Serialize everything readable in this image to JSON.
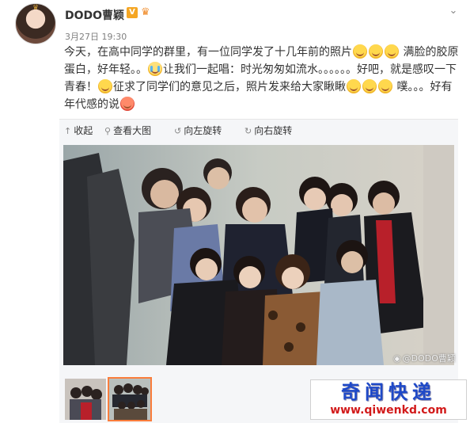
{
  "header": {
    "username": "DODO曹颖",
    "verified_badge": "V",
    "time": "3月27日 19:30",
    "more_icon": "chevron-down-icon"
  },
  "post": {
    "line1_a": "今天，在高中同学的群里，有一位同学发了十几年前的照片",
    "line1_b": "满脸的胶原蛋白，好年轻。。",
    "line2_a": "让我们一起唱：时光匆匆如流水。。。。。。好吧，就是感叹一下青春！",
    "line2_b": "征求了同学们的意见之后，照片发来给大家瞅瞅",
    "line3": "噗。。。好有年代感的说"
  },
  "toolbar": {
    "collapse": "收起",
    "view_large": "查看大图",
    "rotate_left": "向左旋转",
    "rotate_right": "向右旋转"
  },
  "photo": {
    "watermark": "@DODO曹颖"
  },
  "site_logo": {
    "title": "奇闻快递",
    "url": "www.qiwenkd.com"
  },
  "colors": {
    "accent": "#fa7d3c",
    "toolbar_bg": "#f5f6f8",
    "logo_blue": "#1e49c8",
    "logo_red": "#d21a1a"
  }
}
